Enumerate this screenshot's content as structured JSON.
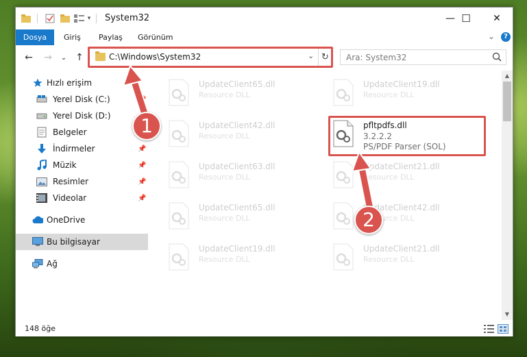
{
  "window": {
    "title": "System32",
    "controls": {
      "minimize": "—",
      "maximize": "☐",
      "close": "✕"
    }
  },
  "ribbon": {
    "tabs": [
      "Dosya",
      "Giriş",
      "Paylaş",
      "Görünüm"
    ],
    "active_tab": "Dosya",
    "expand": "⌄",
    "help": "?"
  },
  "address": {
    "path": "C:\\Windows\\System32",
    "dropdown": "⌄",
    "refresh": "↻",
    "back": "←",
    "forward": "→",
    "recent": "⌄",
    "up": "↑"
  },
  "search": {
    "placeholder": "Ara: System32"
  },
  "navigation": {
    "items": [
      {
        "label": "Hızlı erişim",
        "icon": "star-icon"
      },
      {
        "label": "Yerel Disk (C:)",
        "icon": "drive-icon"
      },
      {
        "label": "Yerel Disk (D:)",
        "icon": "drive-icon"
      },
      {
        "label": "Belgeler",
        "icon": "documents-icon"
      },
      {
        "label": "İndirmeler",
        "icon": "download-icon"
      },
      {
        "label": "Müzik",
        "icon": "music-icon"
      },
      {
        "label": "Resimler",
        "icon": "pictures-icon"
      },
      {
        "label": "Videolar",
        "icon": "videos-icon"
      },
      {
        "label": "OneDrive",
        "icon": "cloud-icon"
      },
      {
        "label": "Bu bilgisayar",
        "icon": "computer-icon"
      },
      {
        "label": "Ağ",
        "icon": "network-icon"
      }
    ]
  },
  "files": {
    "left": [
      {
        "name": "UpdateClient65.dll",
        "desc": "Resource DLL"
      },
      {
        "name": "UpdateClient42.dll",
        "desc": "Resource DLL"
      },
      {
        "name": "UpdateClient63.dll",
        "desc": "Resource DLL"
      },
      {
        "name": "UpdateClient65.dll",
        "desc": "Resource DLL"
      },
      {
        "name": "UpdateClient19.dll",
        "desc": "Resource DLL"
      }
    ],
    "right": [
      {
        "name": "UpdateClient19.dll",
        "desc": "Resource DLL"
      },
      {
        "name": "UpdateClient21.dll",
        "desc": "Resource DLL"
      },
      {
        "name": "UpdateClient42.dll",
        "desc": "Resource DLL"
      },
      {
        "name": "UpdateClient21.dll",
        "desc": "Resource DLL"
      }
    ],
    "highlighted": {
      "name": "pfltpdfs.dll",
      "version": "3.2.2.2",
      "desc": "PS/PDF Parser (SOL)"
    }
  },
  "status": {
    "count": "148 öğe"
  },
  "annotations": {
    "step1": "1",
    "step2": "2"
  },
  "colors": {
    "accent": "#1979ca",
    "highlight": "#d9534f"
  }
}
